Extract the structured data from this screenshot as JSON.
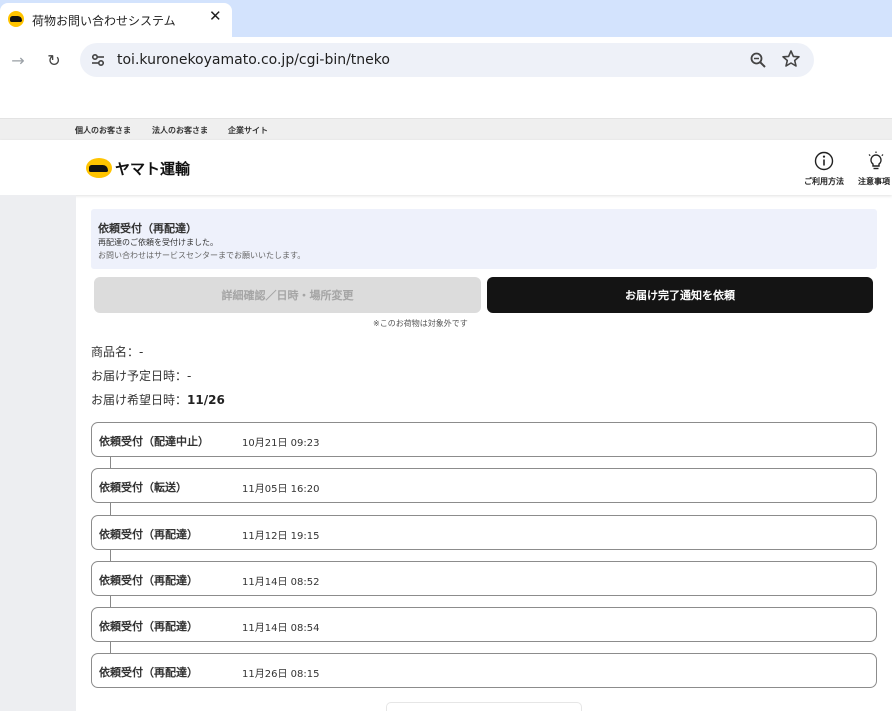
{
  "browser": {
    "tab": {
      "title": "荷物お問い合わせシステム",
      "close_glyph": "✕"
    },
    "toolbar": {
      "back_glyph": "→",
      "reload_glyph": "↻"
    },
    "address_bar": {
      "url": "toi.kuronekoyamato.co.jp/cgi-bin/tneko"
    }
  },
  "site": {
    "top_links": [
      "個人のお客さま",
      "法人のお客さま",
      "企業サイト"
    ],
    "logo_text": "ヤマト運輸",
    "header_icons": [
      {
        "label": "ご利用方法",
        "icon": "info-icon"
      },
      {
        "label": "注意事項",
        "icon": "lightbulb-icon"
      }
    ]
  },
  "status": {
    "title": "依頼受付（再配達）",
    "message": "再配達のご依頼を受付けました。",
    "note": "お問い合わせはサービスセンターまでお願いいたします。"
  },
  "actions": {
    "change_label": "詳細確認／日時・場所変更",
    "notify_label": "お届け完了通知を依頼",
    "excluded_note": "※このお荷物は対象外です"
  },
  "details": {
    "product_label": "商品名：",
    "product_value": "-",
    "scheduled_label": "お届け予定日時：",
    "scheduled_value": "-",
    "requested_label": "お届け希望日時：",
    "requested_value": "11/26"
  },
  "history": [
    {
      "status": "依頼受付（配達中止）",
      "datetime": "10月21日 09:23"
    },
    {
      "status": "依頼受付（転送）",
      "datetime": "11月05日 16:20"
    },
    {
      "status": "依頼受付（再配達）",
      "datetime": "11月12日 19:15"
    },
    {
      "status": "依頼受付（再配達）",
      "datetime": "11月14日 08:52"
    },
    {
      "status": "依頼受付（再配達）",
      "datetime": "11月14日 08:54"
    },
    {
      "status": "依頼受付（再配達）",
      "datetime": "11月26日 08:15"
    }
  ],
  "colors": {
    "accent_yellow": "#ffc400",
    "primary_button": "#141414",
    "status_background": "#eef1fb"
  }
}
